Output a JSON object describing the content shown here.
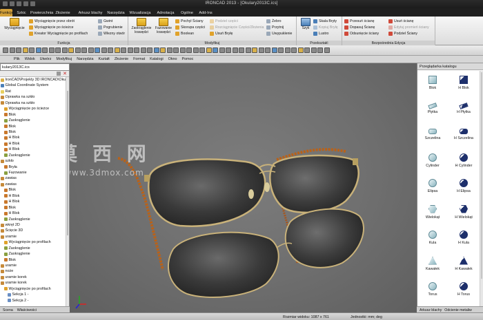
{
  "window": {
    "title": "IRONCAD 2013 - [Okulary2013C.ics]"
  },
  "menu_tabs": [
    {
      "label": "Funkcje",
      "active": true
    },
    {
      "label": "Szkic",
      "active": false
    },
    {
      "label": "Powierzchnia",
      "active": false
    },
    {
      "label": "Złożenie",
      "active": false
    },
    {
      "label": "Arkusz blachy",
      "active": false
    },
    {
      "label": "Narzędzia",
      "active": false
    },
    {
      "label": "Wizualizacja",
      "active": false
    },
    {
      "label": "Adnotacja",
      "active": false
    },
    {
      "label": "Ogólne",
      "active": false
    },
    {
      "label": "Add-Ins",
      "active": false
    }
  ],
  "ribbon": {
    "funkcja": {
      "label": "Funkcja",
      "big_button": "Wyciągnięcie",
      "items": [
        "Wyciągnięcie przez obrót",
        "Wyciągnięcie po ścieżce",
        "Kreator Wyciągnięcie po profilach"
      ],
      "items2": [
        "Gwint",
        "Pogrubienie",
        "Wlezny otwór"
      ]
    },
    "modyfikuj": {
      "label": "Modyfikuj",
      "big1": "Zaokrąglenie krawędzi",
      "big2": "Fazowanie krawędzi",
      "items": [
        "Pochyl Ściany",
        "Skorupa części",
        "Boolean"
      ],
      "items2_disabled": [
        "Podziel części",
        "Rozciągnięcie Części/Złożenia"
      ],
      "items2": [
        "Usuń Bryłę"
      ],
      "items3": [
        "Żebro",
        "Przytnij",
        "Uwypuklenie"
      ]
    },
    "przeksztalc": {
      "label": "Przekształć",
      "big": "Szyk",
      "items": [
        "Skala Bryły",
        "Kopiuj Bryłę",
        "Lustro"
      ]
    },
    "bezposrednia": {
      "label": "Bezpośrednia Edycja",
      "items": [
        "Przesuń ścianę",
        "Dopasuj Ścianę",
        "Odsunięcie ściany"
      ],
      "items2": [
        "Usuń ścianę",
        "Podziel Ściany"
      ],
      "items2_disabled": [
        "Edytuj promień ściany"
      ]
    }
  },
  "menu_bar": [
    "Plik",
    "Widok",
    "Utwórz",
    "Modyfikuj",
    "Narzędzia",
    "Kształt",
    "Złożenie",
    "Format",
    "Katalogi",
    "Okno",
    "Pomoc"
  ],
  "document_tab": "kulary2013C.ics",
  "tree": {
    "rows": [
      {
        "text": "IronCAD\\Projekty 3D IRONCAD\\Okulary",
        "indent": 0,
        "icon": "folder"
      },
      {
        "text": "Global Coordinate System",
        "indent": 0,
        "icon": "axes"
      },
      {
        "text": "Rat",
        "indent": 0,
        "icon": "light"
      },
      {
        "text": "Oprawka na szkło",
        "indent": 0,
        "icon": "part"
      },
      {
        "text": "Oprawka na szkło",
        "indent": 0,
        "icon": "part"
      },
      {
        "text": "Wyciągnięcie po ścieżce",
        "indent": 1,
        "icon": "feature"
      },
      {
        "text": "Blok",
        "indent": 1,
        "icon": "block"
      },
      {
        "text": "Zaokrąglenie",
        "indent": 1,
        "icon": "round"
      },
      {
        "text": "Blok",
        "indent": 1,
        "icon": "block"
      },
      {
        "text": "Blok",
        "indent": 1,
        "icon": "block"
      },
      {
        "text": "H Blok",
        "indent": 1,
        "icon": "block"
      },
      {
        "text": "H Blok",
        "indent": 1,
        "icon": "block"
      },
      {
        "text": "H Blok",
        "indent": 1,
        "icon": "block"
      },
      {
        "text": "Zaokrąglenie",
        "indent": 1,
        "icon": "round"
      },
      {
        "text": "szkło",
        "indent": 0,
        "icon": "part"
      },
      {
        "text": "Bryła",
        "indent": 1,
        "icon": "block"
      },
      {
        "text": "Fazowanie",
        "indent": 1,
        "icon": "round"
      },
      {
        "text": "zawias",
        "indent": 0,
        "icon": "part"
      },
      {
        "text": "zawias",
        "indent": 0,
        "icon": "part"
      },
      {
        "text": "Blok",
        "indent": 1,
        "icon": "block"
      },
      {
        "text": "H Blok",
        "indent": 1,
        "icon": "block"
      },
      {
        "text": "H Blok",
        "indent": 1,
        "icon": "block"
      },
      {
        "text": "Blok",
        "indent": 1,
        "icon": "block"
      },
      {
        "text": "H Blok",
        "indent": 1,
        "icon": "block"
      },
      {
        "text": "Zaokrąglenie",
        "indent": 1,
        "icon": "round"
      },
      {
        "text": "wkręt 2D",
        "indent": 0,
        "icon": "part"
      },
      {
        "text": "Ścięcie 3D",
        "indent": 0,
        "icon": "part"
      },
      {
        "text": "uramie",
        "indent": 0,
        "icon": "part"
      },
      {
        "text": "Wyciągnięcie po profilach",
        "indent": 1,
        "icon": "feature"
      },
      {
        "text": "Zaokrąglenie",
        "indent": 1,
        "icon": "round"
      },
      {
        "text": "Zaokrąglenie",
        "indent": 1,
        "icon": "round"
      },
      {
        "text": "Blok",
        "indent": 1,
        "icon": "block"
      },
      {
        "text": "uramie",
        "indent": 0,
        "icon": "part"
      },
      {
        "text": "noże",
        "indent": 0,
        "icon": "part"
      },
      {
        "text": "uramie korek",
        "indent": 0,
        "icon": "part"
      },
      {
        "text": "uramie korek",
        "indent": 0,
        "icon": "part"
      },
      {
        "text": "Wyciągnięcie po profilach",
        "indent": 1,
        "icon": "feature"
      },
      {
        "text": "Sekcja 1 -",
        "indent": 2,
        "icon": "sketch"
      },
      {
        "text": "Sekcja 2 -",
        "indent": 2,
        "icon": "sketch"
      }
    ],
    "tabs": [
      "Scena",
      "Właściwości"
    ]
  },
  "catalog": {
    "title": "Przeglądarka katalogu",
    "items": [
      {
        "label": "Blok",
        "shape": "cube-light"
      },
      {
        "label": "H Blok",
        "shape": "cube-dark"
      },
      {
        "label": "Płytka",
        "shape": "slab-light"
      },
      {
        "label": "H Płytka",
        "shape": "slab-dark"
      },
      {
        "label": "Szczelina",
        "shape": "slot-light"
      },
      {
        "label": "H Szczelina",
        "shape": "slot-dark"
      },
      {
        "label": "Cylinder",
        "shape": "cyl-light"
      },
      {
        "label": "H Cylinder",
        "shape": "cyl-dark"
      },
      {
        "label": "Elipsa",
        "shape": "ellip-light"
      },
      {
        "label": "H Elipsa",
        "shape": "ellip-dark"
      },
      {
        "label": "Wielokąt",
        "shape": "poly-light"
      },
      {
        "label": "H Wielokąt",
        "shape": "poly-dark"
      },
      {
        "label": "Kula",
        "shape": "ball-light"
      },
      {
        "label": "H Kula",
        "shape": "ball-dark"
      },
      {
        "label": "Kawałek",
        "shape": "wedge-light"
      },
      {
        "label": "H Kawałek",
        "shape": "wedge-dark"
      },
      {
        "label": "Torus",
        "shape": "torus-light"
      },
      {
        "label": "H Torus",
        "shape": "torus-dark"
      }
    ],
    "tabs": [
      "Arkusz blachy",
      "Odcienie metaliw"
    ]
  },
  "watermark": {
    "chars": "莫 西 网",
    "url": "www.3dmox.com"
  },
  "status": {
    "viewport_size": "Rozmiar widoku: 1087 x 761",
    "units": "Jednostki: mm; deg"
  },
  "colors": {
    "accent_tab": "#d4a13a",
    "viewport_bg": "#6e6e6e",
    "frame_gold": "#c9b27a",
    "lens": "#2c2c2c",
    "tortoise": "#c76b1c"
  }
}
